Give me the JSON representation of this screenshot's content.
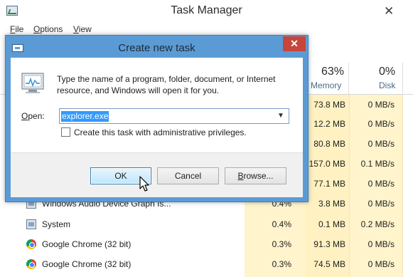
{
  "task_manager": {
    "title": "Task Manager",
    "close_glyph": "✕",
    "menu": [
      {
        "label": "File",
        "mnemonic": "F",
        "rest": "ile"
      },
      {
        "label": "Options",
        "mnemonic": "O",
        "rest": "ptions"
      },
      {
        "label": "View",
        "mnemonic": "V",
        "rest": "iew"
      }
    ],
    "columns": {
      "memory": {
        "percent": "63%",
        "label": "Memory"
      },
      "disk": {
        "percent": "0%",
        "label": "Disk"
      }
    },
    "rows": [
      {
        "name": "",
        "cpu": "",
        "memory": "73.8 MB",
        "disk": "0 MB/s",
        "icon": ""
      },
      {
        "name": "",
        "cpu": "",
        "memory": "12.2 MB",
        "disk": "0 MB/s",
        "icon": ""
      },
      {
        "name": "",
        "cpu": "",
        "memory": "80.8 MB",
        "disk": "0 MB/s",
        "icon": ""
      },
      {
        "name": "",
        "cpu": "",
        "memory": "157.0 MB",
        "disk": "0.1 MB/s",
        "icon": ""
      },
      {
        "name": "",
        "cpu": "",
        "memory": "77.1 MB",
        "disk": "0 MB/s",
        "icon": ""
      },
      {
        "name": "Windows Audio Device Graph Is...",
        "cpu": "0.4%",
        "memory": "3.8 MB",
        "disk": "0 MB/s",
        "icon": "system-icon"
      },
      {
        "name": "System",
        "cpu": "0.4%",
        "memory": "0.1 MB",
        "disk": "0.2 MB/s",
        "icon": "system-icon"
      },
      {
        "name": "Google Chrome (32 bit)",
        "cpu": "0.3%",
        "memory": "91.3 MB",
        "disk": "0 MB/s",
        "icon": "chrome-icon"
      },
      {
        "name": "Google Chrome (32 bit)",
        "cpu": "0.3%",
        "memory": "74.5 MB",
        "disk": "0 MB/s",
        "icon": "chrome-icon"
      }
    ]
  },
  "dialog": {
    "title": "Create new task",
    "close_glyph": "✕",
    "description_line1": "Type the name of a program, folder, document, or Internet",
    "description_line2": "resource, and Windows will open it for you.",
    "open_label": "Open:",
    "open_value": "explorer.exe",
    "combo_arrow": "▼",
    "admin_checkbox_label": "Create this task with administrative privileges.",
    "admin_checked": false,
    "buttons": {
      "ok": "OK",
      "cancel": "Cancel",
      "browse": "Browse..."
    }
  },
  "colors": {
    "dialog_frame": "#5b9bd5",
    "close_button": "#c7453a",
    "heat_column": "#fff1c1",
    "selection": "#3399ff"
  }
}
